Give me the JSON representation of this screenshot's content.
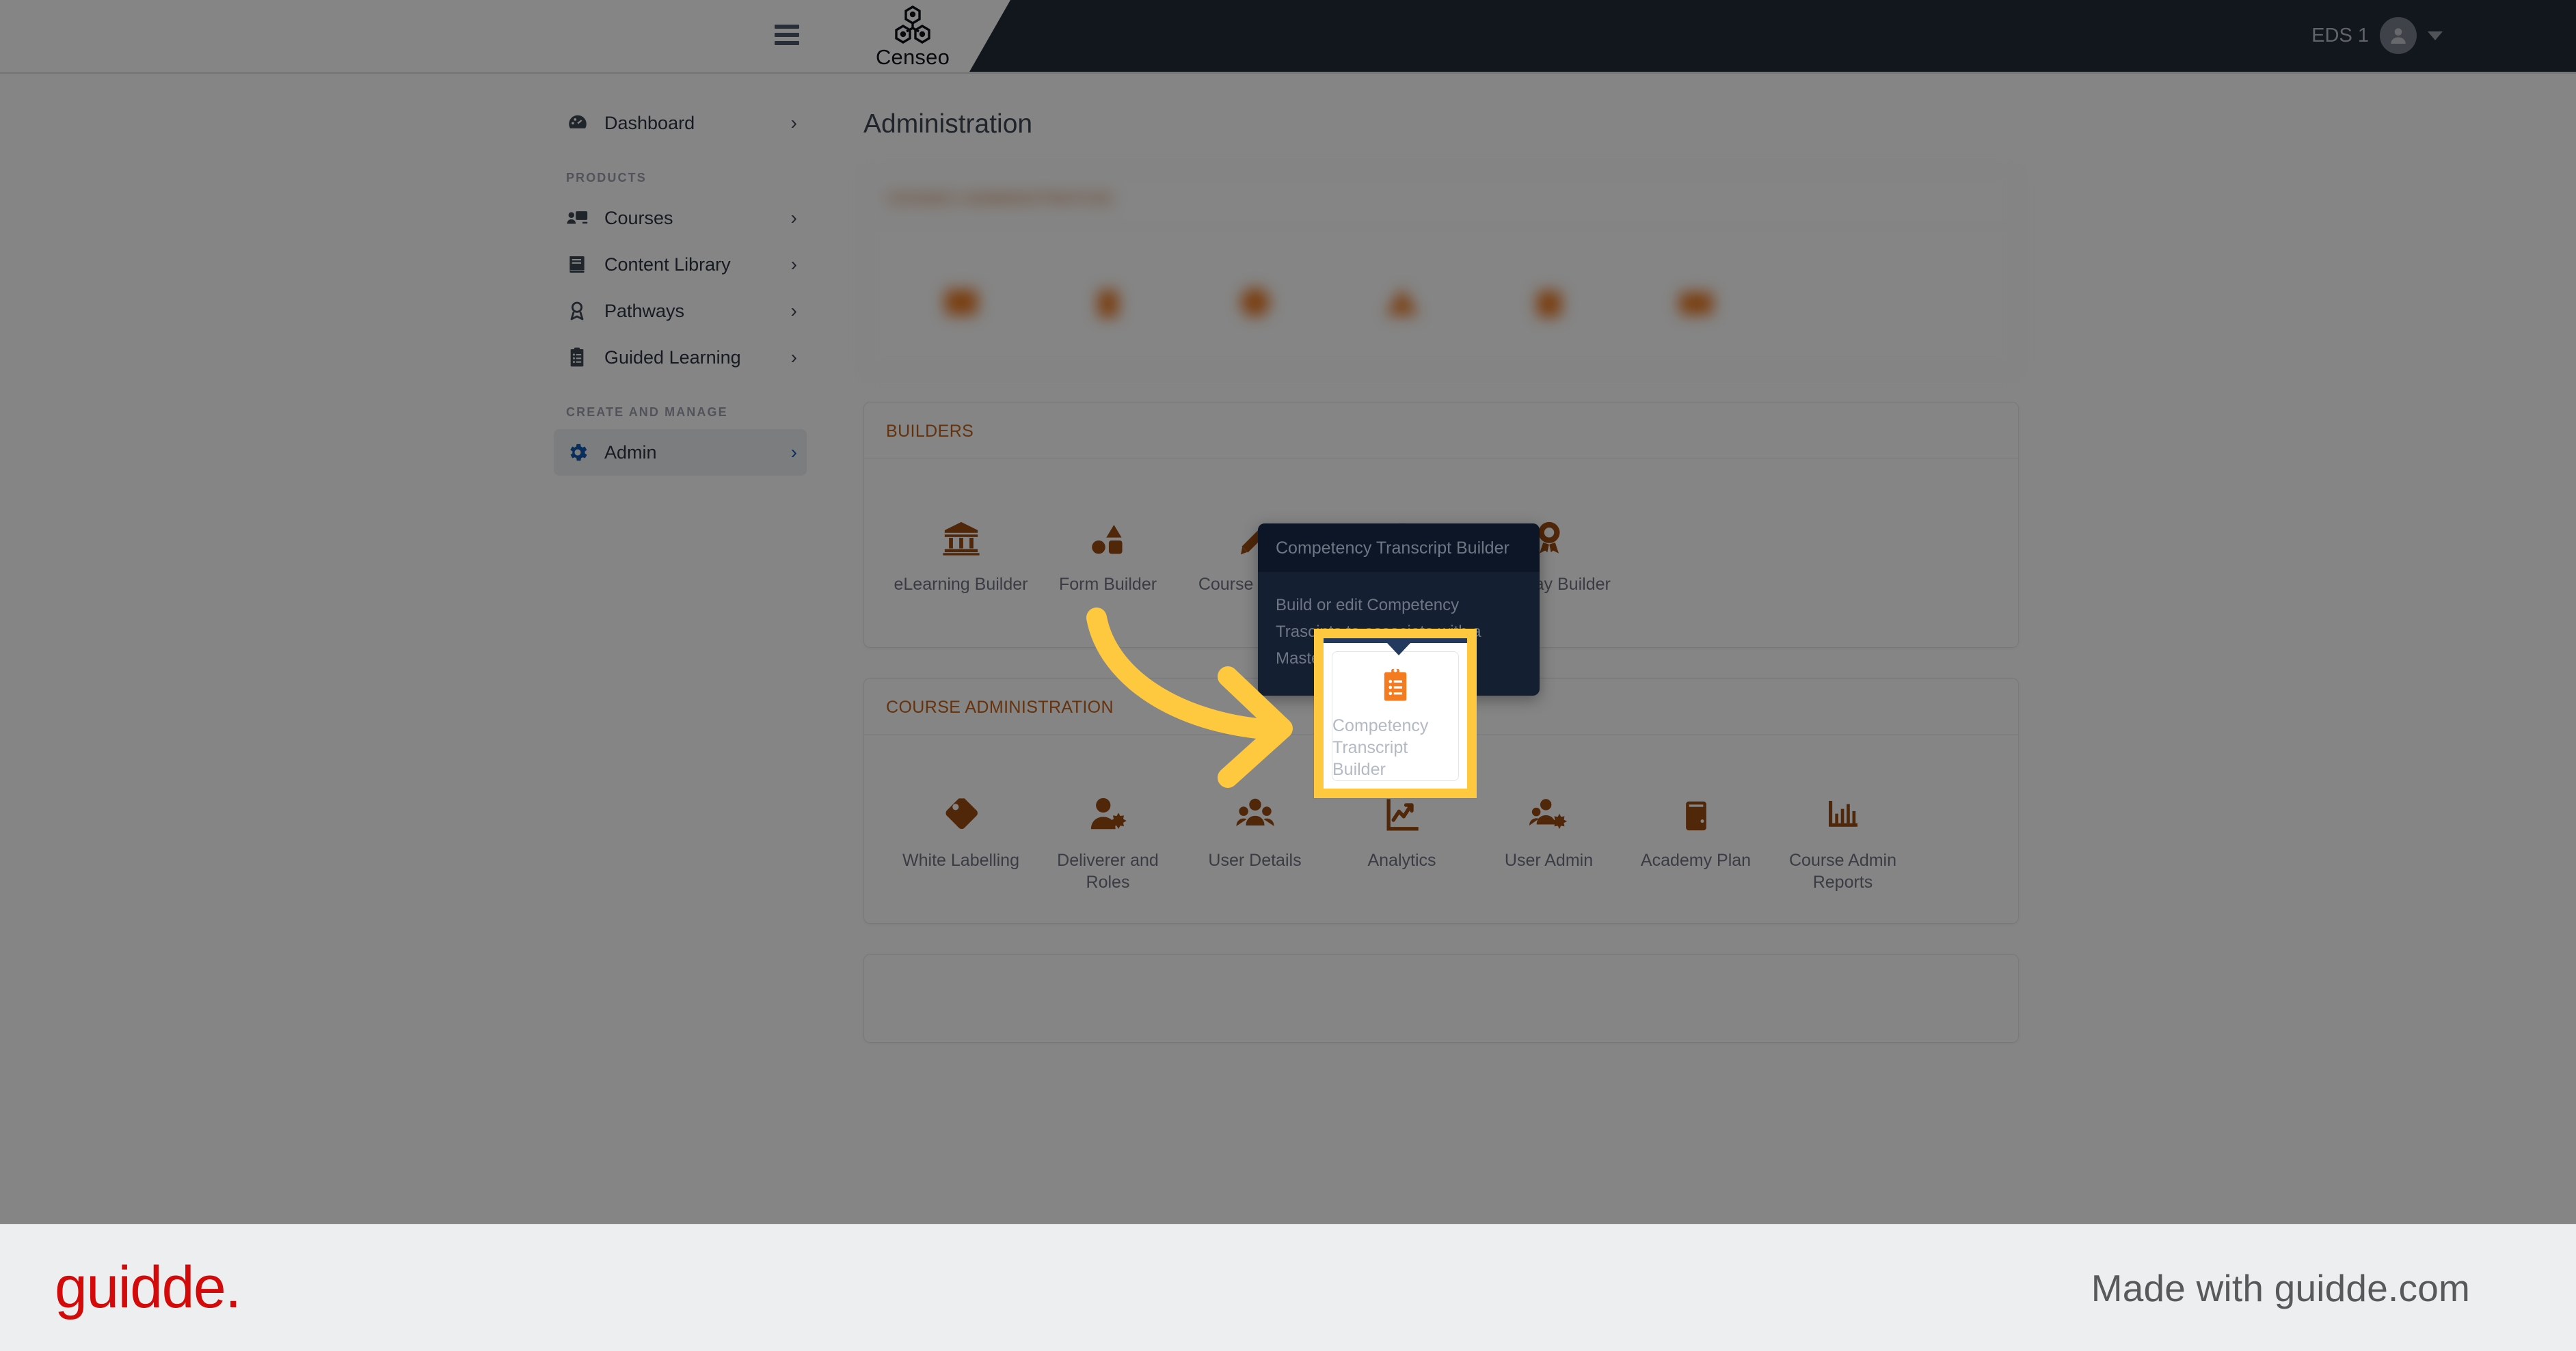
{
  "topbar": {
    "menu_icon": "hamburger-menu-icon",
    "brand_name": "Censeo",
    "brand_logo_icon": "censeo-molecule-logo",
    "user_name": "EDS 1",
    "avatar_icon": "user-avatar-icon",
    "caret_icon": "chevron-down-icon"
  },
  "sidebar": {
    "items": [
      {
        "label": "Dashboard",
        "icon": "dashboard-gauge-icon",
        "chevron": "›",
        "active": false
      },
      {
        "label": "Courses",
        "icon": "courses-screen-icon",
        "chevron": "›",
        "active": false
      },
      {
        "label": "Content Library",
        "icon": "content-library-book-icon",
        "chevron": "›",
        "active": false
      },
      {
        "label": "Pathways",
        "icon": "pathways-award-icon",
        "chevron": "›",
        "active": false
      },
      {
        "label": "Guided Learning",
        "icon": "guided-learning-clipboard-icon",
        "chevron": "›",
        "active": false
      },
      {
        "label": "Admin",
        "icon": "admin-gear-icon",
        "chevron": "›",
        "active": true
      }
    ],
    "section_products": "PRODUCTS",
    "section_create_manage": "CREATE AND MANAGE"
  },
  "main": {
    "page_title": "Administration",
    "cards": [
      {
        "title": "CENSEO ADMINISTRATION",
        "blurred": true,
        "tiles": [
          {
            "label": "",
            "icon": "blurred-icon-1"
          },
          {
            "label": "",
            "icon": "blurred-icon-2"
          },
          {
            "label": "",
            "icon": "blurred-icon-3"
          },
          {
            "label": "",
            "icon": "blurred-icon-4"
          },
          {
            "label": "",
            "icon": "blurred-icon-5"
          },
          {
            "label": "",
            "icon": "blurred-icon-6"
          }
        ]
      },
      {
        "title": "BUILDERS",
        "blurred": false,
        "tiles": [
          {
            "label": "eLearning Builder",
            "icon": "bank-columns-icon"
          },
          {
            "label": "Form Builder",
            "icon": "shapes-icon"
          },
          {
            "label": "Course Builder",
            "icon": "pencil-icon"
          },
          {
            "label": "Competency Transcript Builder",
            "icon": "clipboard-list-icon"
          },
          {
            "label": "Pathway Builder",
            "icon": "ribbon-award-icon"
          }
        ]
      },
      {
        "title": "COURSE ADMINISTRATION",
        "blurred": false,
        "tiles": [
          {
            "label": "White Labelling",
            "icon": "tag-icon"
          },
          {
            "label": "Deliverer and Roles",
            "icon": "user-gear-icon"
          },
          {
            "label": "User Details",
            "icon": "users-group-icon"
          },
          {
            "label": "Analytics",
            "icon": "chart-line-icon"
          },
          {
            "label": "User Admin",
            "icon": "users-gear-icon"
          },
          {
            "label": "Academy Plan",
            "icon": "book-icon"
          },
          {
            "label": "Course Admin Reports",
            "icon": "bar-chart-icon"
          }
        ]
      }
    ]
  },
  "highlight": {
    "tile_label": "Competency Transcript Builder",
    "tile_icon": "clipboard-list-icon",
    "border_color": "#ffc93f",
    "accent_color": "#233a5e"
  },
  "tooltip": {
    "title": "Competency Transcript Builder",
    "body": "Build or edit Competency Trascipts to associate with a Master Course"
  },
  "annotation": {
    "arrow_color": "#ffc93f",
    "arrow_icon": "curved-arrow-icon"
  },
  "footer": {
    "logo_text": "guidde.",
    "made_with_text": "Made with guidde.com",
    "logo_color": "#d40a0a"
  },
  "colors": {
    "accent_orange": "#c0601a",
    "icon_orange": "#e8771f",
    "dark_navy": "#232c3b",
    "tooltip_bg": "#151f32",
    "highlight_yellow": "#ffc93f"
  }
}
